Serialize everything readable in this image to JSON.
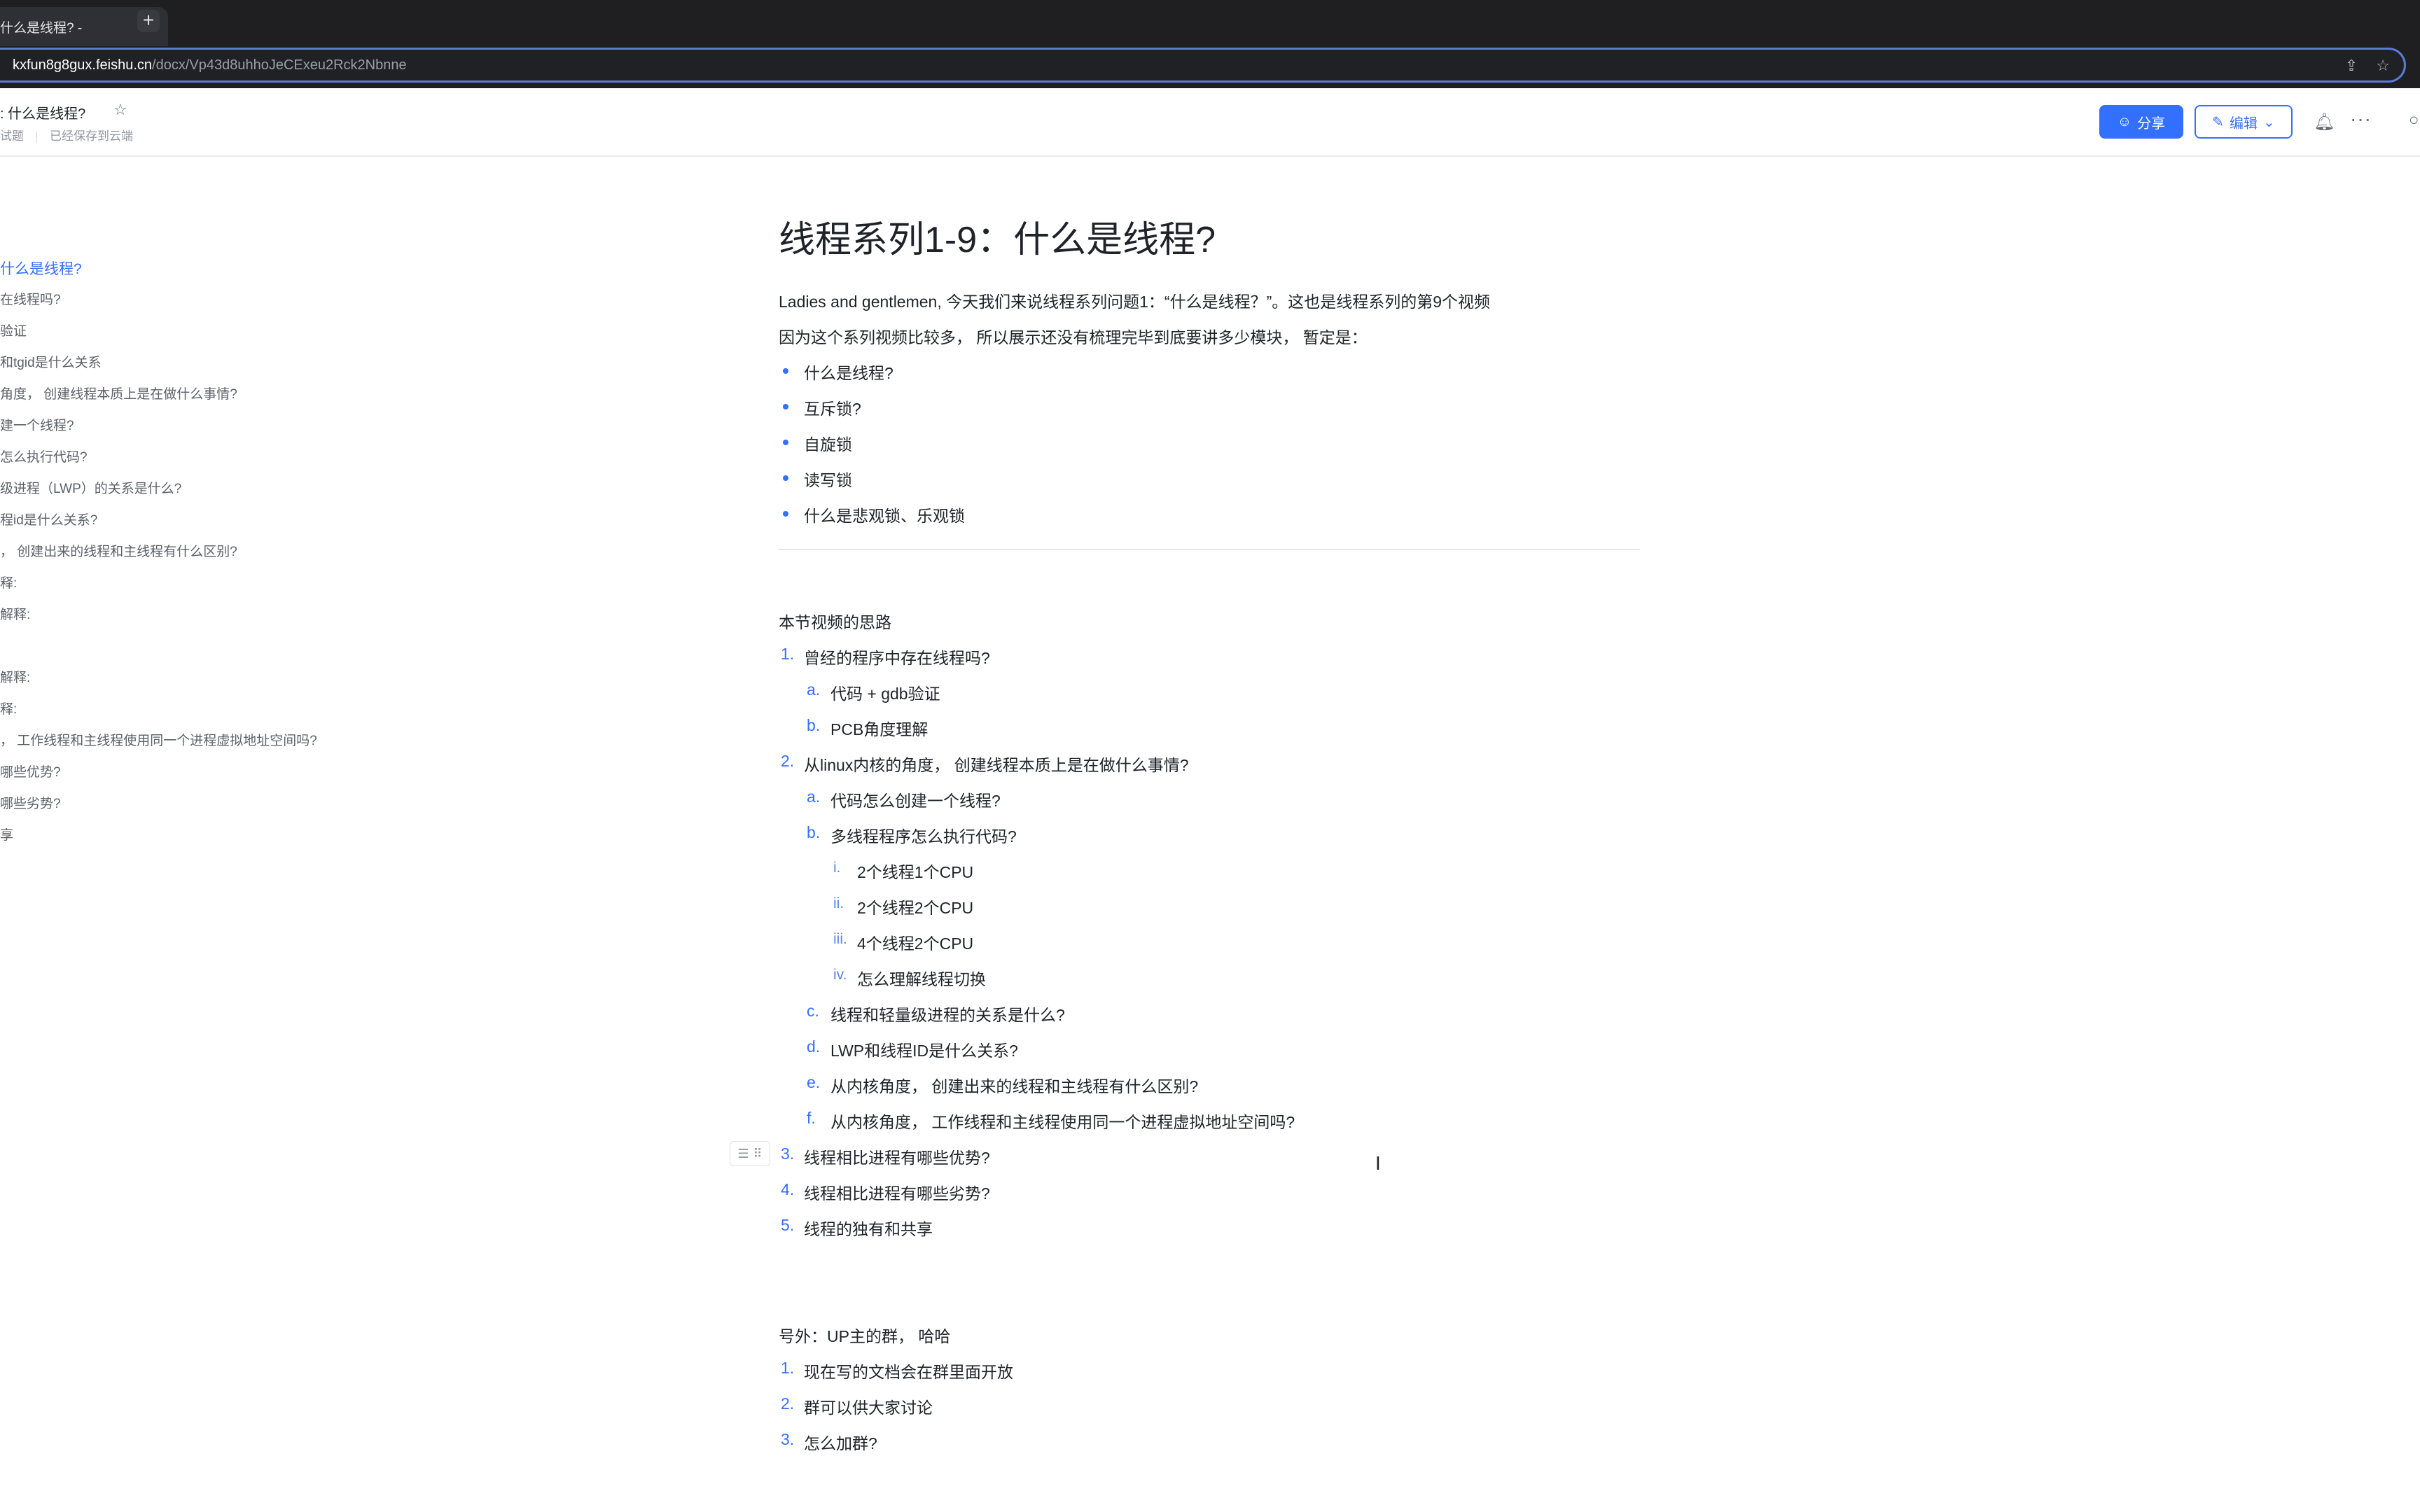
{
  "browser": {
    "tab_title": "什么是线程? - ",
    "tab_close": "×",
    "new_tab": "+",
    "url_host": "kxfun8g8gux.feishu.cn",
    "url_path": "/docx/Vp43d8uhhoJeCExeu2Rck2Nbnne",
    "url_icons": [
      "share-icon",
      "bookmark-star-icon"
    ]
  },
  "header": {
    "title_small": ":  什么是线程?",
    "sub_left": "试题",
    "sub_right": "已经保存到云端",
    "share_label": "分享",
    "edit_label": "编辑",
    "icons": [
      "star-icon",
      "bell-icon",
      "more-icon",
      "search-icon"
    ]
  },
  "outline": {
    "items": [
      {
        "label": "什么是线程?",
        "active": true
      },
      {
        "label": "在线程吗?"
      },
      {
        "label": "验证"
      },
      {
        "label": "和tgid是什么关系"
      },
      {
        "label": "角度，  创建线程本质上是在做什么事情?"
      },
      {
        "label": "建一个线程?"
      },
      {
        "label": "怎么执行代码?"
      },
      {
        "label": "级进程（LWP）的关系是什么?"
      },
      {
        "label": "程id是什么关系?"
      },
      {
        "label": "，  创建出来的线程和主线程有什么区别?"
      },
      {
        "label": "释:"
      },
      {
        "label": "解释:"
      },
      {
        "label": ""
      },
      {
        "label": "解释:"
      },
      {
        "label": "释:"
      },
      {
        "label": "，  工作线程和主线程使用同一个进程虚拟地址空间吗?"
      },
      {
        "label": "哪些优势?"
      },
      {
        "label": "哪些劣势?"
      },
      {
        "label": "享"
      }
    ]
  },
  "doc": {
    "title": "线程系列1-9：什么是线程?",
    "intro1": "Ladies and gentlemen,   今天我们来说线程系列问题1：“什么是线程？”。这也是线程系列的第9个视频",
    "intro2": "因为这个系列视频比较多，  所以展示还没有梳理完毕到底要讲多少模块，  暂定是：",
    "bullets": [
      "什么是线程?",
      "互斥锁?",
      "自旋锁",
      "读写锁",
      "什么是悲观锁、乐观锁"
    ],
    "section_title": "本节视频的思路",
    "outline_list": [
      {
        "marker": "1.",
        "text": "曾经的程序中存在线程吗?",
        "level": 0
      },
      {
        "marker": "a.",
        "text": "代码 + gdb验证",
        "level": 1
      },
      {
        "marker": "b.",
        "text": "PCB角度理解",
        "level": 1
      },
      {
        "marker": "2.",
        "text": "从linux内核的角度，  创建线程本质上是在做什么事情?",
        "level": 0
      },
      {
        "marker": "a.",
        "text": "代码怎么创建一个线程?",
        "level": 1
      },
      {
        "marker": "b.",
        "text": "多线程程序怎么执行代码?",
        "level": 1
      },
      {
        "marker": "i.",
        "text": "2个线程1个CPU",
        "level": 2
      },
      {
        "marker": "ii.",
        "text": "2个线程2个CPU",
        "level": 2
      },
      {
        "marker": "iii.",
        "text": "4个线程2个CPU",
        "level": 2
      },
      {
        "marker": "iv.",
        "text": "怎么理解线程切换",
        "level": 2
      },
      {
        "marker": "c.",
        "text": "线程和轻量级进程的关系是什么?",
        "level": 1
      },
      {
        "marker": "d.",
        "text": "LWP和线程ID是什么关系?",
        "level": 1
      },
      {
        "marker": "e.",
        "text": "从内核角度，  创建出来的线程和主线程有什么区别?",
        "level": 1
      },
      {
        "marker": "f.",
        "text": "从内核角度，  工作线程和主线程使用同一个进程虚拟地址空间吗?",
        "level": 1
      },
      {
        "marker": "3.",
        "text": "线程相比进程有哪些优势?",
        "level": 0
      },
      {
        "marker": "4.",
        "text": "线程相比进程有哪些劣势?",
        "level": 0
      },
      {
        "marker": "5.",
        "text": "线程的独有和共享",
        "level": 0
      }
    ],
    "extra_title": "号外：UP主的群，  哈哈",
    "extra_list": [
      {
        "marker": "1.",
        "text": "现在写的文档会在群里面开放"
      },
      {
        "marker": "2.",
        "text": "群可以供大家讨论"
      },
      {
        "marker": "3.",
        "text": "怎么加群?"
      }
    ]
  },
  "colors": {
    "accent": "#3370ff",
    "text": "#1f2329",
    "muted": "#8f959e"
  }
}
